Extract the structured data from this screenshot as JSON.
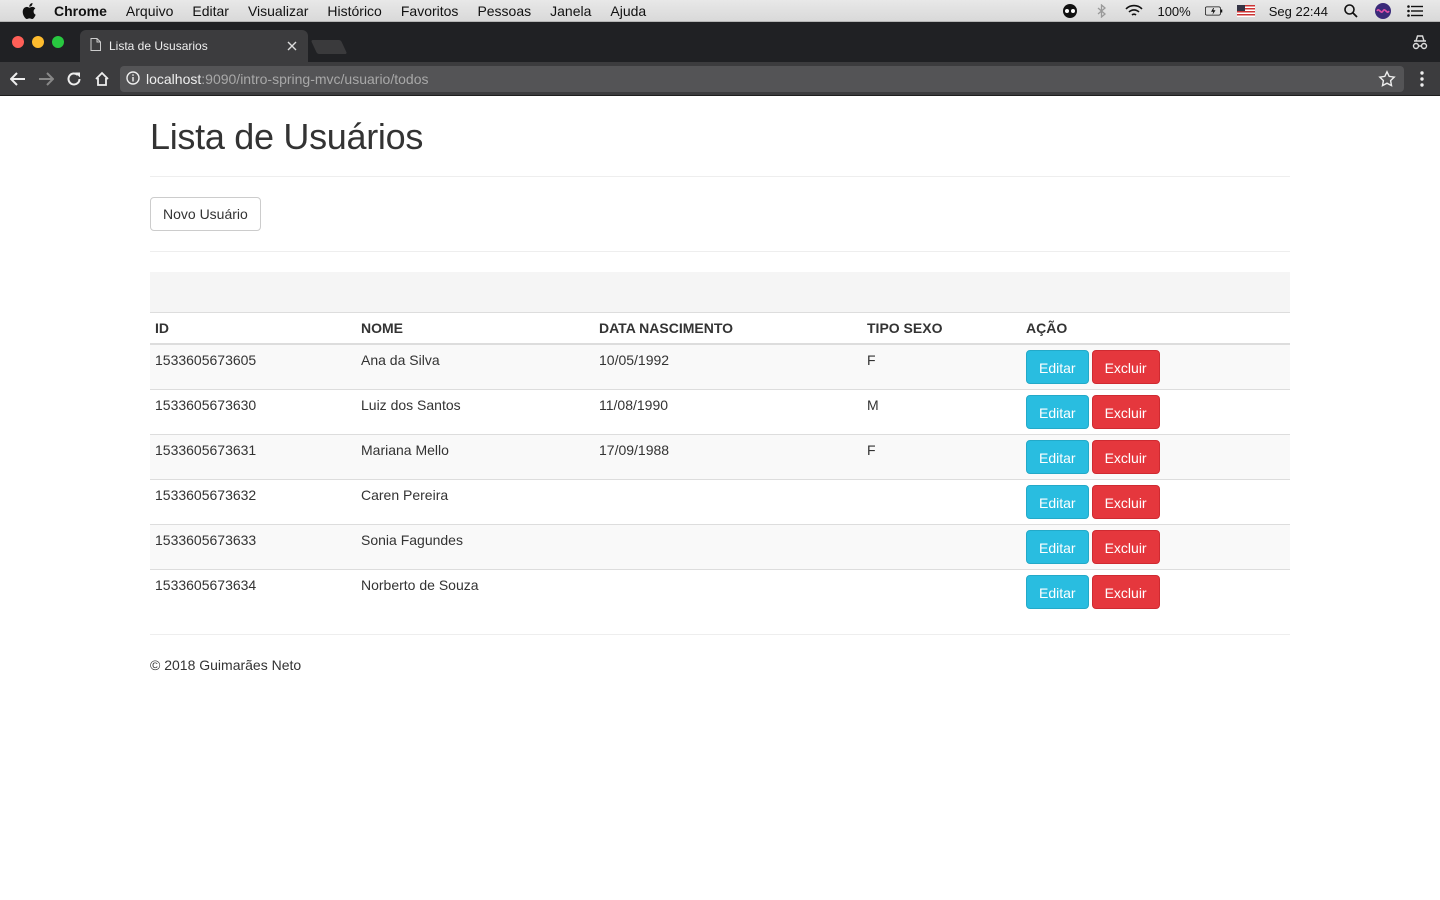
{
  "menubar": {
    "items": [
      "Chrome",
      "Arquivo",
      "Editar",
      "Visualizar",
      "Histórico",
      "Favoritos",
      "Pessoas",
      "Janela",
      "Ajuda"
    ],
    "battery": "100%",
    "clock": "Seg 22:44"
  },
  "browser": {
    "tab_title": "Lista de Ususarios",
    "url_host": "localhost",
    "url_rest": ":9090/intro-spring-mvc/usuario/todos"
  },
  "page": {
    "title": "Lista de Usuários",
    "new_user_label": "Novo Usuário",
    "table": {
      "headers": [
        "ID",
        "NOME",
        "DATA NASCIMENTO",
        "TIPO SEXO",
        "AÇÃO"
      ],
      "rows": [
        {
          "id": "1533605673605",
          "nome": "Ana da Silva",
          "data": "10/05/1992",
          "sexo": "F"
        },
        {
          "id": "1533605673630",
          "nome": "Luiz dos Santos",
          "data": "11/08/1990",
          "sexo": "M"
        },
        {
          "id": "1533605673631",
          "nome": "Mariana Mello",
          "data": "17/09/1988",
          "sexo": "F"
        },
        {
          "id": "1533605673632",
          "nome": "Caren Pereira",
          "data": "",
          "sexo": ""
        },
        {
          "id": "1533605673633",
          "nome": "Sonia Fagundes",
          "data": "",
          "sexo": ""
        },
        {
          "id": "1533605673634",
          "nome": "Norberto de Souza",
          "data": "",
          "sexo": ""
        }
      ],
      "edit_label": "Editar",
      "delete_label": "Excluir"
    },
    "footer": "© 2018 Guimarães Neto"
  },
  "colors": {
    "info": "#29bde0",
    "danger": "#e5373d"
  }
}
